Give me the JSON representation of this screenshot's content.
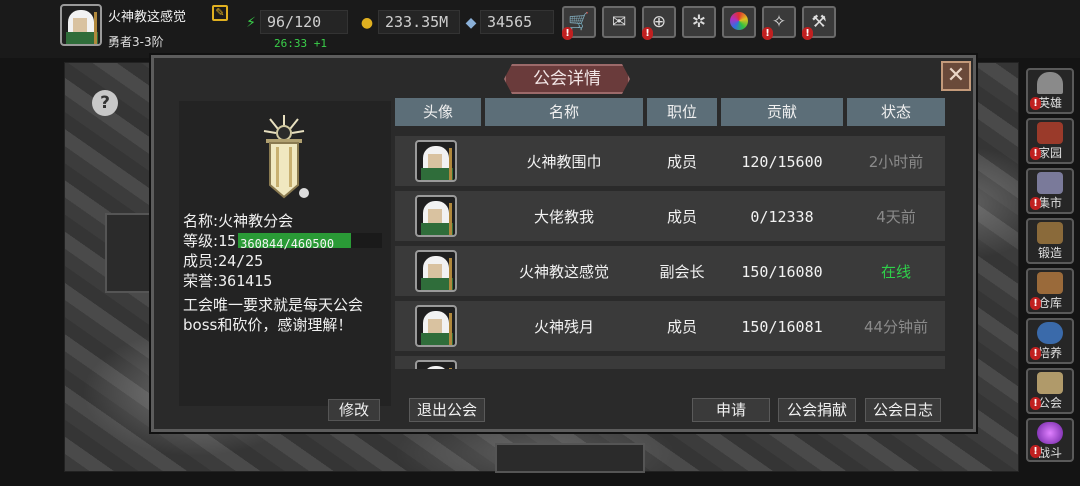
{
  "player": {
    "name": "火神教这感觉",
    "rank": "勇者3-3阶",
    "energy": "96/120",
    "energy_timer": "26:33 +1",
    "gold": "233.35M",
    "gems": "34565"
  },
  "sidebar": {
    "items": [
      {
        "label": "英雄",
        "color": "#8a8a8a",
        "alert": true
      },
      {
        "label": "家园",
        "color": "#9a3a2a",
        "alert": true
      },
      {
        "label": "集市",
        "color": "#7a7a9a",
        "alert": true
      },
      {
        "label": "锻造",
        "color": "#8a6a3a",
        "alert": false
      },
      {
        "label": "仓库",
        "color": "#9a6a3a",
        "alert": true
      },
      {
        "label": "培养",
        "color": "#3a6aaa",
        "alert": true
      },
      {
        "label": "公会",
        "color": "#b09a6a",
        "alert": true
      },
      {
        "label": "战斗",
        "color": "#8a3ab0",
        "alert": true
      }
    ]
  },
  "dialog": {
    "title": "公会详情",
    "close_icon": "close-icon",
    "help_glyph": "?"
  },
  "guild": {
    "name_label": "名称:",
    "name": "火神教分会",
    "level_label": "等级:",
    "level": "15",
    "exp_text": "360844/460500",
    "exp_progress": 0.7836,
    "members_label": "成员:",
    "members": "24/25",
    "honor_label": "荣誉:",
    "honor": "361415",
    "notice": "工会唯一要求就是每天公会boss和砍价，感谢理解！",
    "edit_label": "修改"
  },
  "table": {
    "headers": [
      "头像",
      "名称",
      "职位",
      "贡献",
      "状态"
    ],
    "rows": [
      {
        "name": "火神教围巾",
        "role": "成员",
        "contribution": "120/15600",
        "status": "2小时前",
        "online": false
      },
      {
        "name": "大佬教我",
        "role": "成员",
        "contribution": "0/12338",
        "status": "4天前",
        "online": false
      },
      {
        "name": "火神教这感觉",
        "role": "副会长",
        "contribution": "150/16080",
        "status": "在线",
        "online": true
      },
      {
        "name": "火神残月",
        "role": "成员",
        "contribution": "150/16081",
        "status": "44分钟前",
        "online": false
      }
    ]
  },
  "actions": {
    "leave": "退出公会",
    "apply": "申请",
    "donate": "公会捐献",
    "log": "公会日志"
  },
  "colors": {
    "online": "#2fd04a",
    "exp_bar": "#2a9a36",
    "title_banner": "#6a3b3b",
    "table_header": "#5c6e78"
  }
}
